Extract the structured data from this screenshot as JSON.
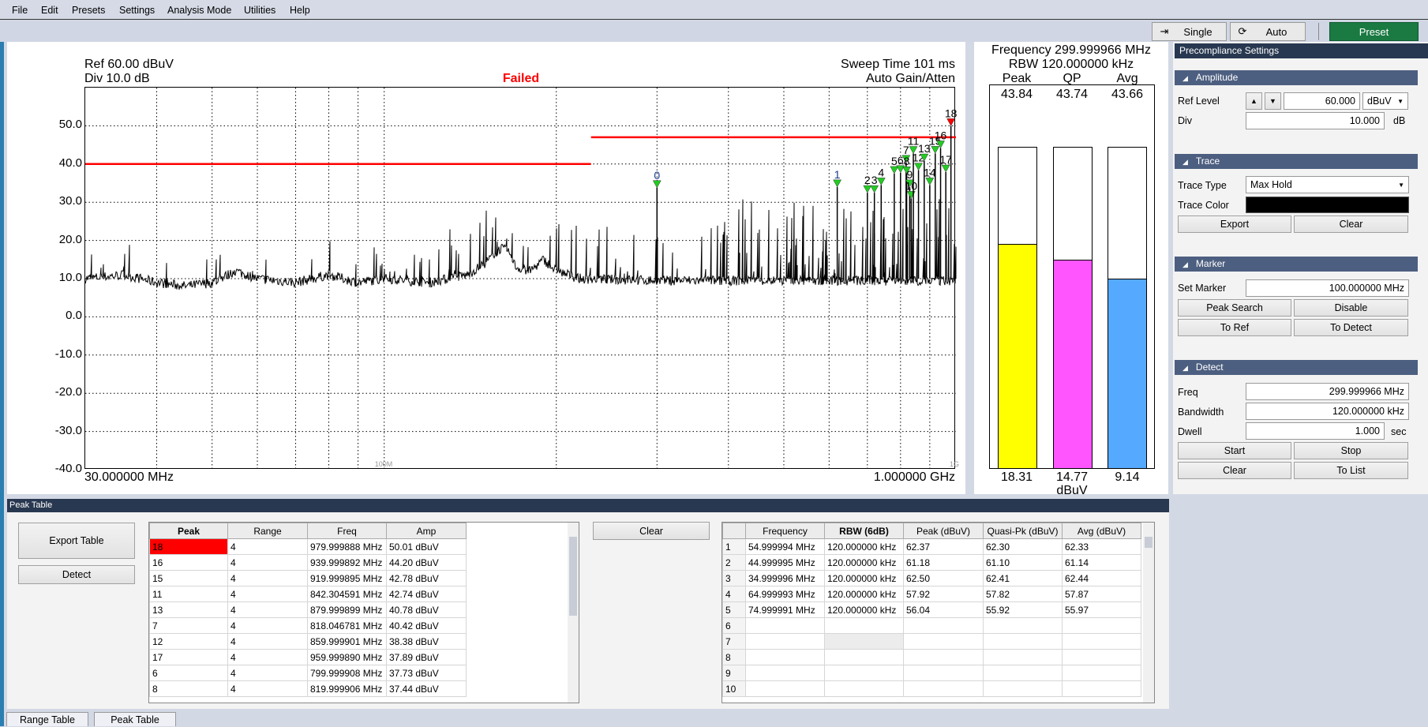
{
  "menu": [
    "File",
    "Edit",
    "Presets",
    "Settings",
    "Analysis Mode",
    "Utilities",
    "Help"
  ],
  "toolbar": {
    "single_label": "Single",
    "auto_label": "Auto",
    "preset_label": "Preset",
    "preset_color": "#1a7a42"
  },
  "plot": {
    "ref_text": "Ref 60.00 dBuV",
    "div_text": "Div 10.0 dB",
    "status": "Failed",
    "status_color": "#ff0000",
    "sweep_text": "Sweep Time 101 ms",
    "gain_text": "Auto Gain/Atten",
    "start_label": "30.000000 MHz",
    "stop_label": "1.000000 GHz",
    "decade_labels": [
      "100M",
      "1G"
    ]
  },
  "chart_data": {
    "type": "line",
    "x_scale": "log",
    "x_unit": "MHz",
    "xlim": [
      30,
      1000
    ],
    "ylim": [
      -40,
      60
    ],
    "y_unit": "dBuV",
    "y_ticks": [
      "50.0",
      "40.0",
      "30.0",
      "20.0",
      "10.0",
      "0.0",
      "-10.0",
      "-20.0",
      "-30.0",
      "-40.0"
    ],
    "grid": true,
    "limit_lines": [
      {
        "from": 30,
        "to": 230,
        "level": 40
      },
      {
        "from": 230,
        "to": 1000,
        "level": 47
      }
    ],
    "limit_color": "#ff0000",
    "trace_color": "#000000",
    "trace_floor": [
      [
        30,
        10
      ],
      [
        35,
        11
      ],
      [
        40,
        9
      ],
      [
        45,
        8
      ],
      [
        50,
        9
      ],
      [
        55,
        12
      ],
      [
        60,
        10
      ],
      [
        70,
        9
      ],
      [
        80,
        11
      ],
      [
        90,
        9
      ],
      [
        100,
        10
      ],
      [
        120,
        9
      ],
      [
        140,
        11
      ],
      [
        150,
        14
      ],
      [
        160,
        18
      ],
      [
        165,
        17
      ],
      [
        170,
        13
      ],
      [
        180,
        12
      ],
      [
        190,
        15
      ],
      [
        200,
        12
      ],
      [
        220,
        10
      ],
      [
        300,
        9.5
      ],
      [
        1000,
        9.5
      ]
    ],
    "markers": [
      {
        "id": "0",
        "freq": 300,
        "amp": 33.8
      },
      {
        "id": "1",
        "freq": 620,
        "amp": 34
      },
      {
        "id": "2",
        "freq": 700,
        "amp": 32.5
      },
      {
        "id": "3",
        "freq": 720,
        "amp": 32.5
      },
      {
        "id": "4",
        "freq": 740,
        "amp": 34.5
      },
      {
        "id": "5",
        "freq": 780,
        "amp": 37.5
      },
      {
        "id": "6",
        "freq": 799.999908,
        "amp": 37.73
      },
      {
        "id": "7",
        "freq": 818.046781,
        "amp": 40.42
      },
      {
        "id": "8",
        "freq": 819.999906,
        "amp": 37.44
      },
      {
        "id": "9",
        "freq": 830,
        "amp": 34
      },
      {
        "id": "10",
        "freq": 835,
        "amp": 31
      },
      {
        "id": "11",
        "freq": 842.304591,
        "amp": 42.74
      },
      {
        "id": "12",
        "freq": 859.999901,
        "amp": 38.38
      },
      {
        "id": "13",
        "freq": 879.999899,
        "amp": 40.78
      },
      {
        "id": "14",
        "freq": 900,
        "amp": 34.5
      },
      {
        "id": "15",
        "freq": 919.999895,
        "amp": 42.78
      },
      {
        "id": "16",
        "freq": 939.999892,
        "amp": 44.2
      },
      {
        "id": "17",
        "freq": 959.99989,
        "amp": 37.89
      },
      {
        "id": "18",
        "freq": 979.999888,
        "amp": 50.01,
        "selected": true
      }
    ],
    "marker_color": "#22cc22",
    "selected_marker_color": "#ff0000"
  },
  "meter": {
    "frequency_text": "Frequency 299.999966 MHz",
    "rbw_text": "RBW 120.000000 kHz",
    "columns": [
      {
        "label": "Peak",
        "value": "43.84",
        "bottom": "18.31",
        "fill_fraction": 0.7,
        "color": "#ffff00"
      },
      {
        "label": "QP",
        "value": "43.74",
        "bottom": "14.77",
        "fill_fraction": 0.65,
        "color": "#ff55ff"
      },
      {
        "label": "Avg",
        "value": "43.66",
        "bottom": "9.14",
        "fill_fraction": 0.59,
        "color": "#55aaff"
      }
    ],
    "unit": "dBuV"
  },
  "settings": {
    "title": "Precompliance Settings",
    "amplitude": {
      "title": "Amplitude",
      "ref_level_label": "Ref Level",
      "ref_level": "60.000",
      "unit": "dBuV",
      "div_label": "Div",
      "div": "10.000",
      "div_unit": "dB"
    },
    "trace": {
      "title": "Trace",
      "type_label": "Trace Type",
      "type": "Max Hold",
      "color_label": "Trace Color",
      "color": "#000000",
      "export": "Export",
      "clear": "Clear"
    },
    "marker": {
      "title": "Marker",
      "set_label": "Set Marker",
      "set_value": "100.000000 MHz",
      "peak_search": "Peak Search",
      "disable": "Disable",
      "to_ref": "To Ref",
      "to_detect": "To Detect"
    },
    "detect": {
      "title": "Detect",
      "freq_label": "Freq",
      "freq": "299.999966 MHz",
      "bw_label": "Bandwidth",
      "bw": "120.000000 kHz",
      "dwell_label": "Dwell",
      "dwell": "1.000",
      "dwell_unit": "sec",
      "start": "Start",
      "stop": "Stop",
      "clear": "Clear",
      "to_list": "To List"
    }
  },
  "peak_table": {
    "title": "Peak Table",
    "export": "Export Table",
    "detect": "Detect",
    "clear": "Clear",
    "columns": [
      "Peak",
      "Range",
      "Freq",
      "Amp"
    ],
    "rows": [
      [
        "18",
        "4",
        "979.999888 MHz",
        "50.01 dBuV"
      ],
      [
        "16",
        "4",
        "939.999892 MHz",
        "44.20 dBuV"
      ],
      [
        "15",
        "4",
        "919.999895 MHz",
        "42.78 dBuV"
      ],
      [
        "11",
        "4",
        "842.304591 MHz",
        "42.74 dBuV"
      ],
      [
        "13",
        "4",
        "879.999899 MHz",
        "40.78 dBuV"
      ],
      [
        "7",
        "4",
        "818.046781 MHz",
        "40.42 dBuV"
      ],
      [
        "12",
        "4",
        "859.999901 MHz",
        "38.38 dBuV"
      ],
      [
        "17",
        "4",
        "959.999890 MHz",
        "37.89 dBuV"
      ],
      [
        "6",
        "4",
        "799.999908 MHz",
        "37.73 dBuV"
      ],
      [
        "8",
        "4",
        "819.999906 MHz",
        "37.44 dBuV"
      ]
    ],
    "detect_columns": [
      "",
      "Frequency",
      "RBW (6dB)",
      "Peak (dBuV)",
      "Quasi-Pk (dBuV)",
      "Avg (dBuV)"
    ],
    "detect_rows": [
      [
        "1",
        "54.999994 MHz",
        "120.000000 kHz",
        "62.37",
        "62.30",
        "62.33"
      ],
      [
        "2",
        "44.999995 MHz",
        "120.000000 kHz",
        "61.18",
        "61.10",
        "61.14"
      ],
      [
        "3",
        "34.999996 MHz",
        "120.000000 kHz",
        "62.50",
        "62.41",
        "62.44"
      ],
      [
        "4",
        "64.999993 MHz",
        "120.000000 kHz",
        "57.92",
        "57.82",
        "57.87"
      ],
      [
        "5",
        "74.999991 MHz",
        "120.000000 kHz",
        "56.04",
        "55.92",
        "55.97"
      ],
      [
        "6",
        "",
        "",
        "",
        "",
        ""
      ],
      [
        "7",
        "",
        "",
        "",
        "",
        ""
      ],
      [
        "8",
        "",
        "",
        "",
        "",
        ""
      ],
      [
        "9",
        "",
        "",
        "",
        "",
        ""
      ],
      [
        "10",
        "",
        "",
        "",
        "",
        ""
      ]
    ]
  },
  "tabs": [
    "Range Table",
    "Peak Table"
  ]
}
